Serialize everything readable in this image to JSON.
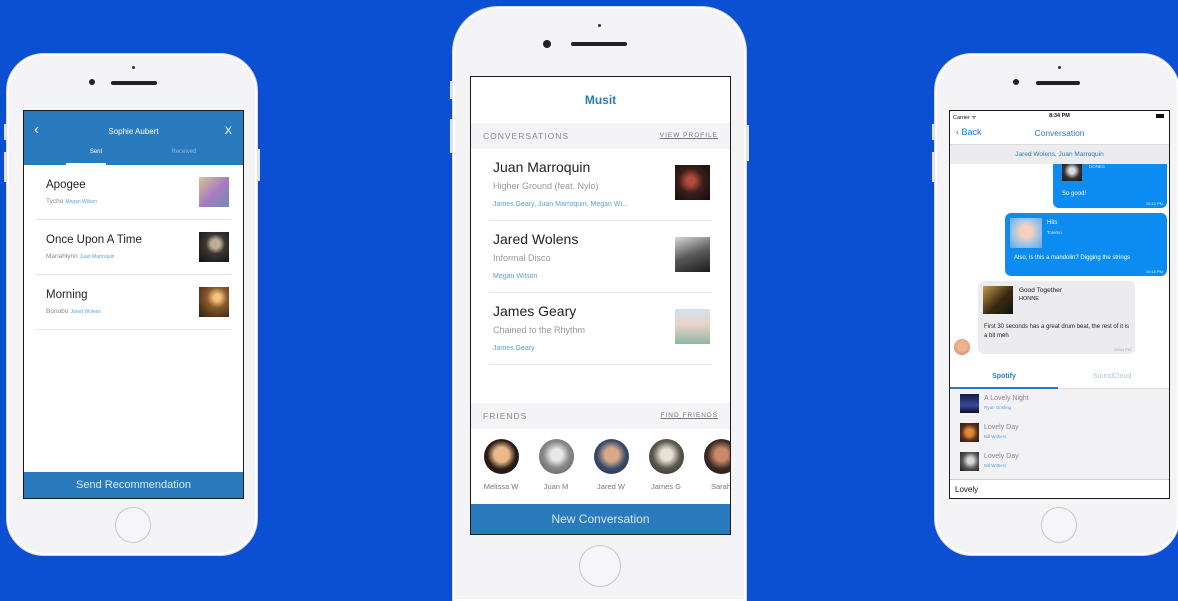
{
  "left": {
    "header": {
      "back": "‹",
      "title": "Sophie Aubert",
      "close": "X"
    },
    "tabs": [
      "Sent",
      "Received"
    ],
    "items": [
      {
        "title": "Apogee",
        "artist": "Tycho",
        "by": "Megan Wilson"
      },
      {
        "title": "Once Upon A Time",
        "artist": "Mariahlynn",
        "by": "Juan Marroquin"
      },
      {
        "title": "Morning",
        "artist": "Bonobo",
        "by": "Jared Wolens"
      }
    ],
    "footer": "Send Recommendation"
  },
  "middle": {
    "title": "Musit",
    "conversations_label": "CONVERSATIONS",
    "view_profile": "VIEW PROFILE",
    "conversations": [
      {
        "name": "Juan Marroquin",
        "song": "Higher Ground (feat. Nylo)",
        "people": "James Geary, Juan Marroquin, Megan Wi..."
      },
      {
        "name": "Jared Wolens",
        "song": "Informal Disco",
        "people": "Megan Wilson"
      },
      {
        "name": "James Geary",
        "song": "Chained to the Rhythm",
        "people": "James Geary"
      }
    ],
    "friends_label": "FRIENDS",
    "find_friends": "FIND FRIENDS",
    "friends": [
      "Melissa W",
      "Juan M",
      "Jared W",
      "James G",
      "Sarah"
    ],
    "footer": "New Conversation"
  },
  "right": {
    "status": {
      "carrier": "Carrier ᯤ",
      "time": "8:34 PM"
    },
    "nav": {
      "back": "‹ Back",
      "title": "Conversation"
    },
    "participants": "Jared Wolens, Juan Marroquin",
    "messages": [
      {
        "text": "So good!",
        "time": "10:12 PM",
        "song_artist": "DONES"
      },
      {
        "song": "Hits",
        "artist": "Totemo",
        "text": "Also, is this a mandolin? Digging the strings",
        "time": "10:15 PM"
      },
      {
        "song": "Good Together",
        "artist": "HONNE",
        "text": "First 30 seconds has a great drum beat, the rest of it is a bit meh",
        "time": "10:54 PM"
      }
    ],
    "tabs": [
      "Spotify",
      "SoundCloud"
    ],
    "results": [
      {
        "title": "A Lovely Night",
        "artist": "Ryan Gosling"
      },
      {
        "title": "Lovely Day",
        "artist": "Bill Withers"
      },
      {
        "title": "Lovely Day",
        "artist": "Bill Withers"
      }
    ],
    "search_value": "Lovely"
  },
  "colors": {
    "background": "#0b4fd3",
    "accent": "#2a7bbd",
    "bubble_mine": "#0c8cf0"
  }
}
